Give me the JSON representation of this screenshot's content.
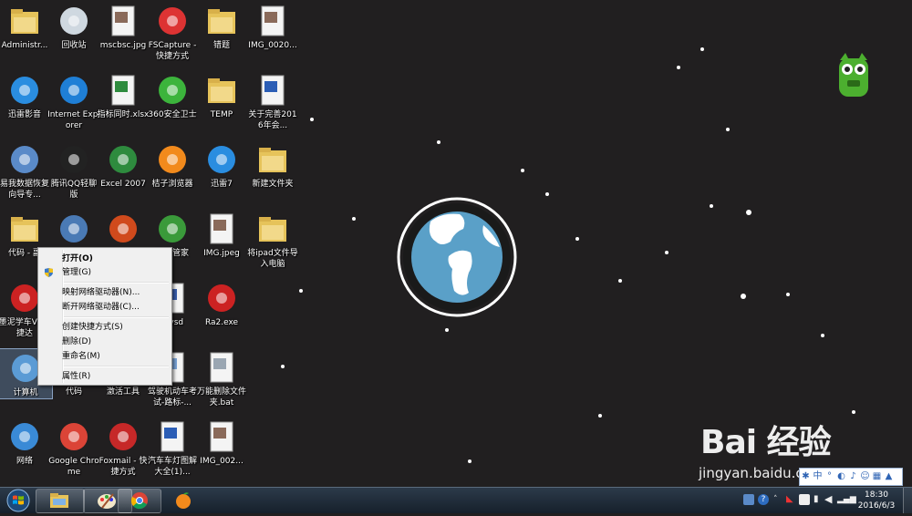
{
  "desktop": {
    "icons": [
      {
        "label": "Administr...",
        "icon": "user-folder-icon"
      },
      {
        "label": "回收站",
        "icon": "recycle-bin-icon"
      },
      {
        "label": "mscbsc.jpg",
        "icon": "image-file-icon"
      },
      {
        "label": "FSCapture - 快捷方式",
        "icon": "fscapture-icon"
      },
      {
        "label": "错题",
        "icon": "folder-icon"
      },
      {
        "label": "IMG_0020...",
        "icon": "image-file-icon"
      },
      {
        "label": "迅雷影音",
        "icon": "xunlei-player-icon"
      },
      {
        "label": "Internet Explorer",
        "icon": "internet-explorer-icon"
      },
      {
        "label": "指标同时.xlsx",
        "icon": "excel-file-icon"
      },
      {
        "label": "360安全卫士",
        "icon": "360-security-icon"
      },
      {
        "label": "TEMP",
        "icon": "folder-icon"
      },
      {
        "label": "关于完善2016年会...",
        "icon": "word-file-icon"
      },
      {
        "label": "易我数据恢复向导专...",
        "icon": "data-recovery-icon"
      },
      {
        "label": "腾讯QQ轻聊版",
        "icon": "qq-icon"
      },
      {
        "label": "Excel 2007",
        "icon": "excel-app-icon"
      },
      {
        "label": "桔子浏览器",
        "icon": "orange-browser-icon"
      },
      {
        "label": "迅雷7",
        "icon": "xunlei-icon"
      },
      {
        "label": "新建文件夹",
        "icon": "folder-icon"
      },
      {
        "label": "代码 - 副",
        "icon": "folder-icon"
      },
      {
        "label": "",
        "icon": "network-computer-icon"
      },
      {
        "label": "",
        "icon": "powerpoint-icon"
      },
      {
        "label": "软件管家",
        "icon": "software-manager-icon"
      },
      {
        "label": "IMG.jpeg",
        "icon": "image-file-icon"
      },
      {
        "label": "将ipad文件导入电脑",
        "icon": "folder-icon"
      },
      {
        "label": "墨泥学车V2.2捷达",
        "icon": "car-app-icon"
      },
      {
        "label": "1.vsd",
        "icon": "visio-file-icon"
      },
      {
        "label": "Ra2.exe",
        "icon": "ra2-icon"
      },
      {
        "label": "计算机",
        "icon": "computer-icon"
      },
      {
        "label": "代码",
        "icon": "folder-icon"
      },
      {
        "label": "激活工具",
        "icon": "tool-icon"
      },
      {
        "label": "驾驶机动车考试-路标-...",
        "icon": "document-file-icon"
      },
      {
        "label": "万能删除文件夹.bat",
        "icon": "batch-file-icon"
      },
      {
        "label": "网络",
        "icon": "network-icon"
      },
      {
        "label": "Google Chrome",
        "icon": "chrome-icon"
      },
      {
        "label": "Foxmail - 快捷方式",
        "icon": "foxmail-icon"
      },
      {
        "label": "汽车车灯图解大全(1)...",
        "icon": "word-file-icon"
      },
      {
        "label": "IMG_002...",
        "icon": "image-file-icon"
      }
    ]
  },
  "context_menu": {
    "items": [
      {
        "label": "打开(O)",
        "bold": true
      },
      {
        "label": "管理(G)",
        "icon": "uac-shield-icon"
      },
      {
        "label": "映射网络驱动器(N)..."
      },
      {
        "label": "断开网络驱动器(C)..."
      },
      {
        "label": "创建快捷方式(S)"
      },
      {
        "label": "删除(D)"
      },
      {
        "label": "重命名(M)"
      },
      {
        "label": "属性(R)"
      }
    ]
  },
  "taskbar": {
    "start_icon": "windows-start-orb-icon",
    "pinned": [
      {
        "name": "explorer",
        "icon": "file-explorer-icon"
      },
      {
        "name": "paint",
        "icon": "paint-icon"
      },
      {
        "name": "chrome",
        "icon": "chrome-icon"
      },
      {
        "name": "orange-browser",
        "icon": "orange-browser-icon"
      }
    ],
    "clock_time": "18:30",
    "clock_date": "2016/6/3"
  },
  "ime_bar": {
    "mode": "中"
  },
  "watermark": {
    "logo": "Bai 经验",
    "url": "jingyan.baidu.com"
  },
  "colors": {
    "desktop_bg": "#211f20",
    "globe_ocean": "#5aa0c8",
    "menu_bg": "#f0f0f0",
    "taskbar_bg": "#1e2a36"
  }
}
